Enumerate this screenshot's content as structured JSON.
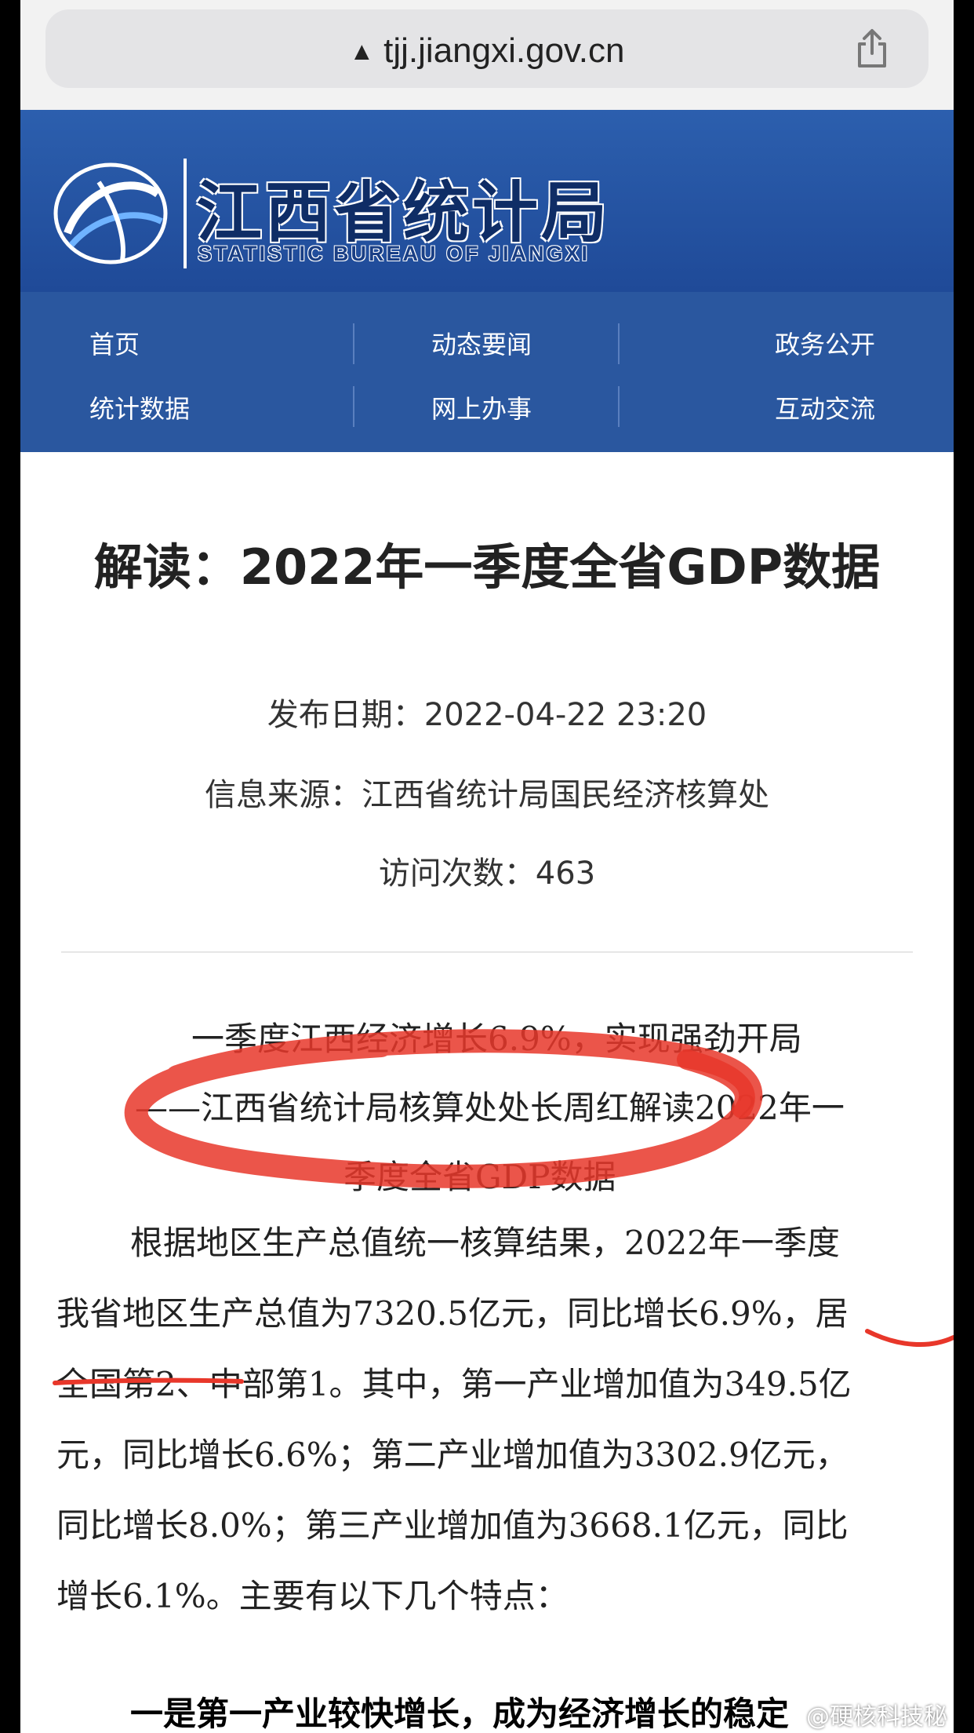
{
  "browser": {
    "url": "tjj.jiangxi.gov.cn",
    "warning_icon": "warning-icon",
    "share_icon": "share-icon"
  },
  "header": {
    "title": "江西省统计局",
    "subtitle": "STATISTIC BUREAU OF JIANGXI"
  },
  "nav": {
    "items": [
      "首页",
      "动态要闻",
      "政务公开",
      "统计数据",
      "网上办事",
      "互动交流"
    ]
  },
  "article": {
    "title": "解读：2022年一季度全省GDP数据",
    "publish_date": "发布日期：2022-04-22 23:20",
    "source": "信息来源：江西省统计局国民经济核算处",
    "visits": "访问次数：463",
    "headline_lines": [
      "一季度江西经济增长6.9%，实现强劲开局",
      "——江西省统计局核算处处长周红解读2022年一",
      "季度全省GDP数据"
    ],
    "body_lines": [
      "根据地区生产总值统一核算结果，2022年一季度",
      "我省地区生产总值为7320.5亿元，同比增长6.9%，居",
      "全国第2、中部第1。其中，第一产业增加值为349.5亿",
      "元，同比增长6.6%；第二产业增加值为3302.9亿元，",
      "同比增长8.0%；第三产业增加值为3668.1亿元，同比",
      "增长6.1%。主要有以下几个特点："
    ],
    "section_heading": "一是第一产业较快增长，成为经济增长的稳定"
  },
  "watermark": "@硬核科技秘",
  "colors": {
    "banner": "#2c5fae",
    "nav": "#2a579f",
    "annotation_red": "#e8372a"
  }
}
